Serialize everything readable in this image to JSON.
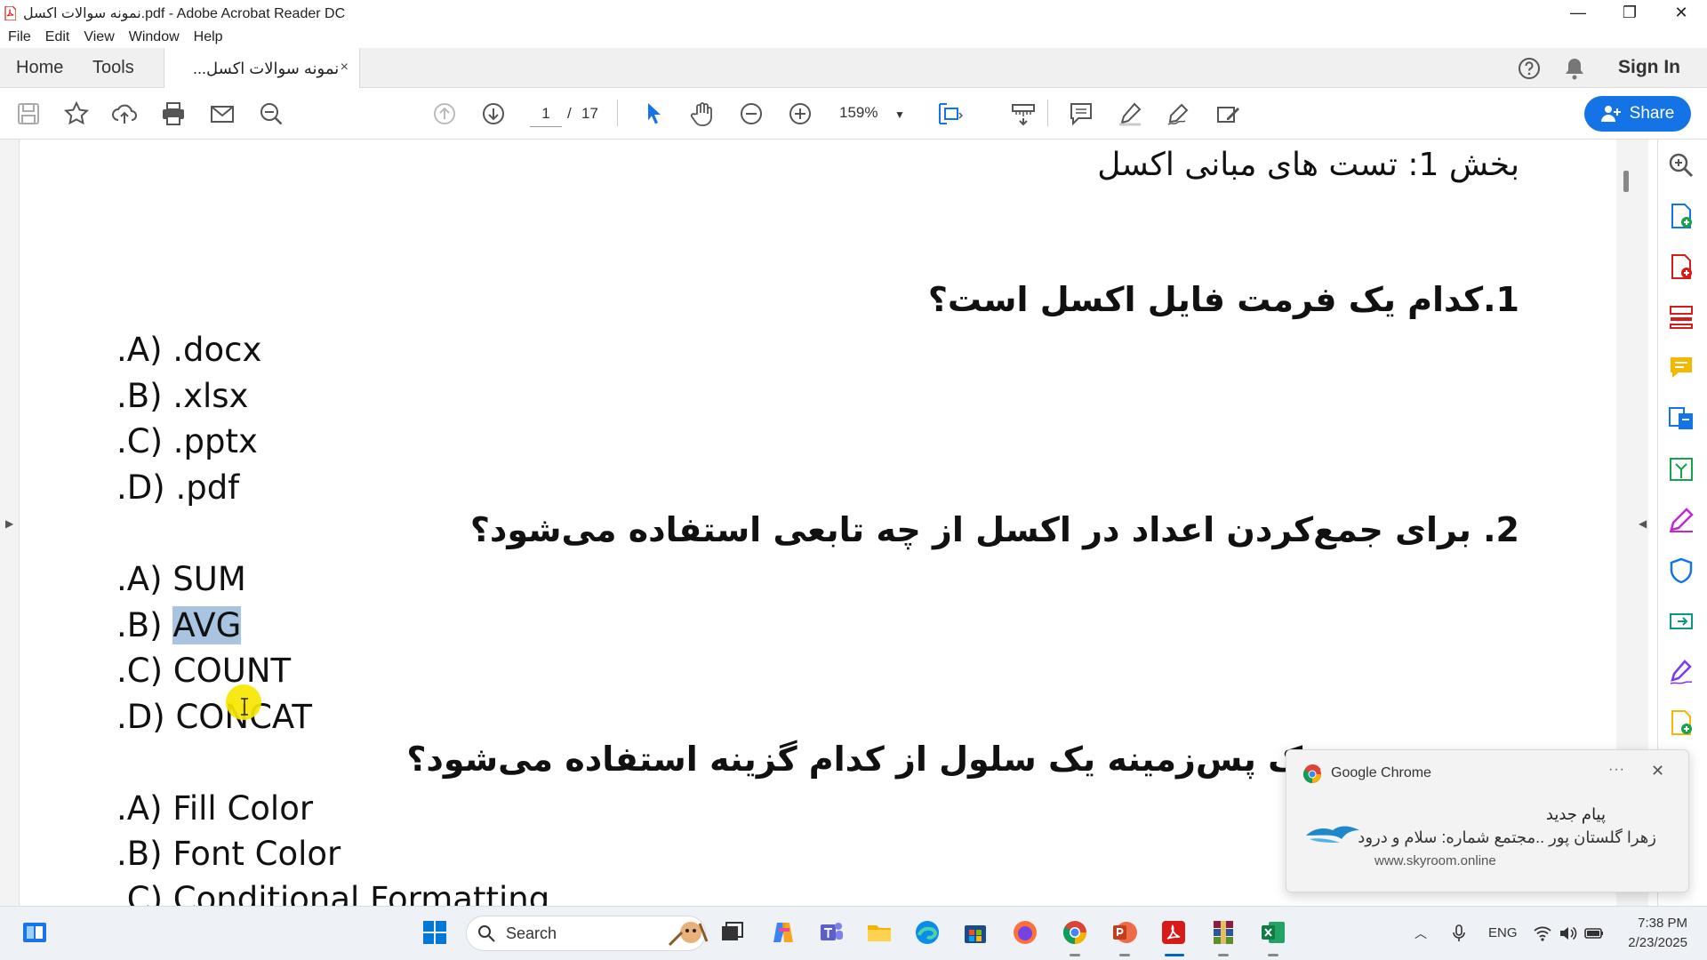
{
  "window": {
    "title": "نمونه سوالات اکسل.pdf - Adobe Acrobat Reader DC",
    "controls": [
      "—",
      "❐",
      "✕"
    ]
  },
  "menu": [
    "File",
    "Edit",
    "View",
    "Window",
    "Help"
  ],
  "tabs": {
    "home": "Home",
    "tools": "Tools",
    "document": "نمونه سوالات اکسل...",
    "close": "×",
    "sign_in": "Sign In"
  },
  "toolbar": {
    "page_current": "1",
    "page_sep": "/",
    "page_total": "17",
    "zoom": "159%",
    "share_label": "Share"
  },
  "document": {
    "section_title": "بخش 1: تست های مبانی اکسل",
    "questions": [
      {
        "title": "1.کدام یک فرمت فایل اکسل است؟",
        "options": [
          ".A) .docx",
          ".B) .xlsx",
          ".C) .pptx",
          ".D) .pdf"
        ]
      },
      {
        "title": "2. برای جمع‌کردن اعداد در اکسل از چه تابعی استفاده می‌شود؟",
        "options_prefix": ".B) ",
        "options": [
          ".A) SUM",
          "AVG",
          ".C) COUNT",
          ".D) CONCAT"
        ]
      },
      {
        "title": "ک پس‌زمینه یک سلول از کدام گزینه استفاده می‌شود؟",
        "options": [
          ".A) Fill Color",
          ".B) Font Color",
          ".C) Conditional Formatting"
        ]
      }
    ]
  },
  "notification": {
    "app": "Google Chrome",
    "more": "···",
    "close": "✕",
    "title": "پیام جدید",
    "body": "زهرا گلستان پور ..مجتمع شماره: سلام و درود",
    "url": "www.skyroom.online"
  },
  "taskbar": {
    "search_placeholder": "Search",
    "lang": "ENG",
    "time": "7:38 PM",
    "date": "2/23/2025"
  },
  "colors": {
    "accent": "#1473e6",
    "acrobat_red": "#d71a1a",
    "highlight": "#a9c4e0",
    "cursor_yellow": "#f7e600"
  }
}
